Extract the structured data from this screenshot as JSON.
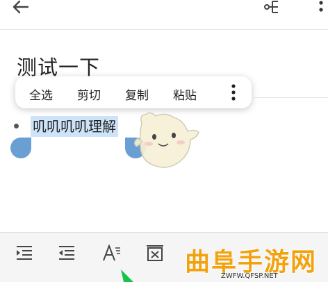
{
  "topbar": {
    "back_icon": "arrow-left-icon",
    "share_icon": "mindmap-share-icon",
    "more_icon": "more-vertical-icon"
  },
  "document": {
    "title": "测试一下",
    "bullet_text": "叽叽叽叽理解"
  },
  "context_menu": {
    "items": [
      "全选",
      "剪切",
      "复制",
      "粘贴"
    ],
    "more_icon": "more-vertical-icon"
  },
  "toolbar": {
    "buttons": [
      "indent-increase-icon",
      "indent-decrease-icon",
      "text-format-icon",
      "delete-box-icon"
    ]
  },
  "watermark": {
    "title": "曲阜手游网",
    "subtitle": "ZWFW.QFSP.NET"
  },
  "colors": {
    "selection": "#cde3f7",
    "handles": "#6a9fd4",
    "watermark": "#f2a20e",
    "toolbar_bg": "#f5f5f5"
  }
}
